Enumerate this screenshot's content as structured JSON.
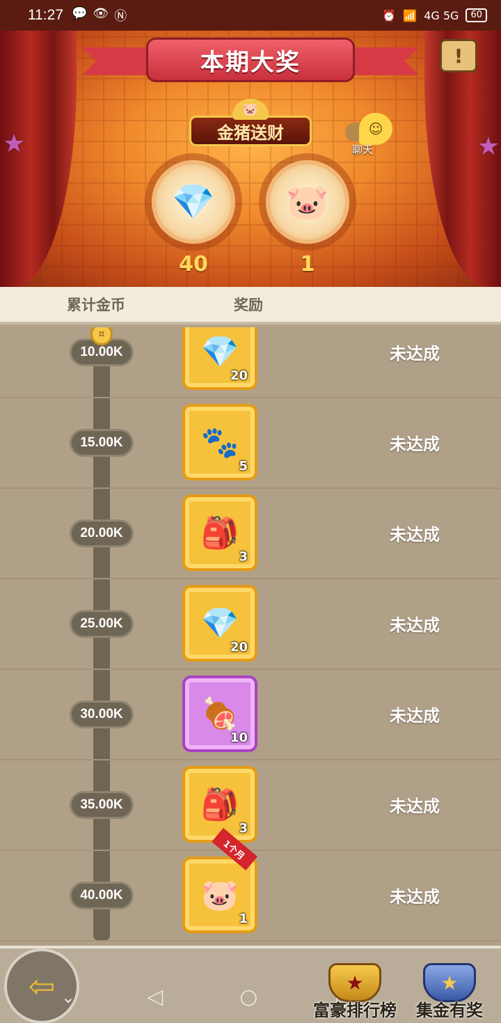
{
  "status_bar": {
    "time": "11:27",
    "network": "4G 5G",
    "battery": "60"
  },
  "header": {
    "title": "本期大奖",
    "event_name": "金猪送财",
    "chat_label": "聊天"
  },
  "grand_prizes": [
    {
      "icon": "crystal-ore-icon",
      "glyph": "💎",
      "count": "40"
    },
    {
      "icon": "golden-pig-card-icon",
      "glyph": "🐷",
      "count": "1"
    }
  ],
  "table": {
    "col_coins": "累计金币",
    "col_reward": "奖励"
  },
  "rows": [
    {
      "amount": "10.00K",
      "icon": "crystal-ore-icon",
      "glyph": "💎",
      "qty": "20",
      "status": "未达成",
      "style": "gold"
    },
    {
      "amount": "15.00K",
      "icon": "paw-stone-icon",
      "glyph": "🐾",
      "qty": "5",
      "status": "未达成",
      "style": "gold"
    },
    {
      "amount": "20.00K",
      "icon": "bunny-bag-icon",
      "glyph": "🎒",
      "qty": "3",
      "status": "未达成",
      "style": "gold"
    },
    {
      "amount": "25.00K",
      "icon": "crystal-ore-icon",
      "glyph": "💎",
      "qty": "20",
      "status": "未达成",
      "style": "gold"
    },
    {
      "amount": "30.00K",
      "icon": "mystery-bone-icon",
      "glyph": "🍖",
      "qty": "10",
      "status": "未达成",
      "style": "purple"
    },
    {
      "amount": "35.00K",
      "icon": "bunny-bag-icon",
      "glyph": "🎒",
      "qty": "3",
      "status": "未达成",
      "style": "gold"
    },
    {
      "amount": "40.00K",
      "icon": "golden-pig-card-icon",
      "glyph": "🐷",
      "qty": "1",
      "status": "未达成",
      "style": "gold",
      "tag": "1个月"
    }
  ],
  "bottom_tabs": {
    "rich_rank": "富豪排行榜",
    "collect_reward": "集金有奖"
  }
}
